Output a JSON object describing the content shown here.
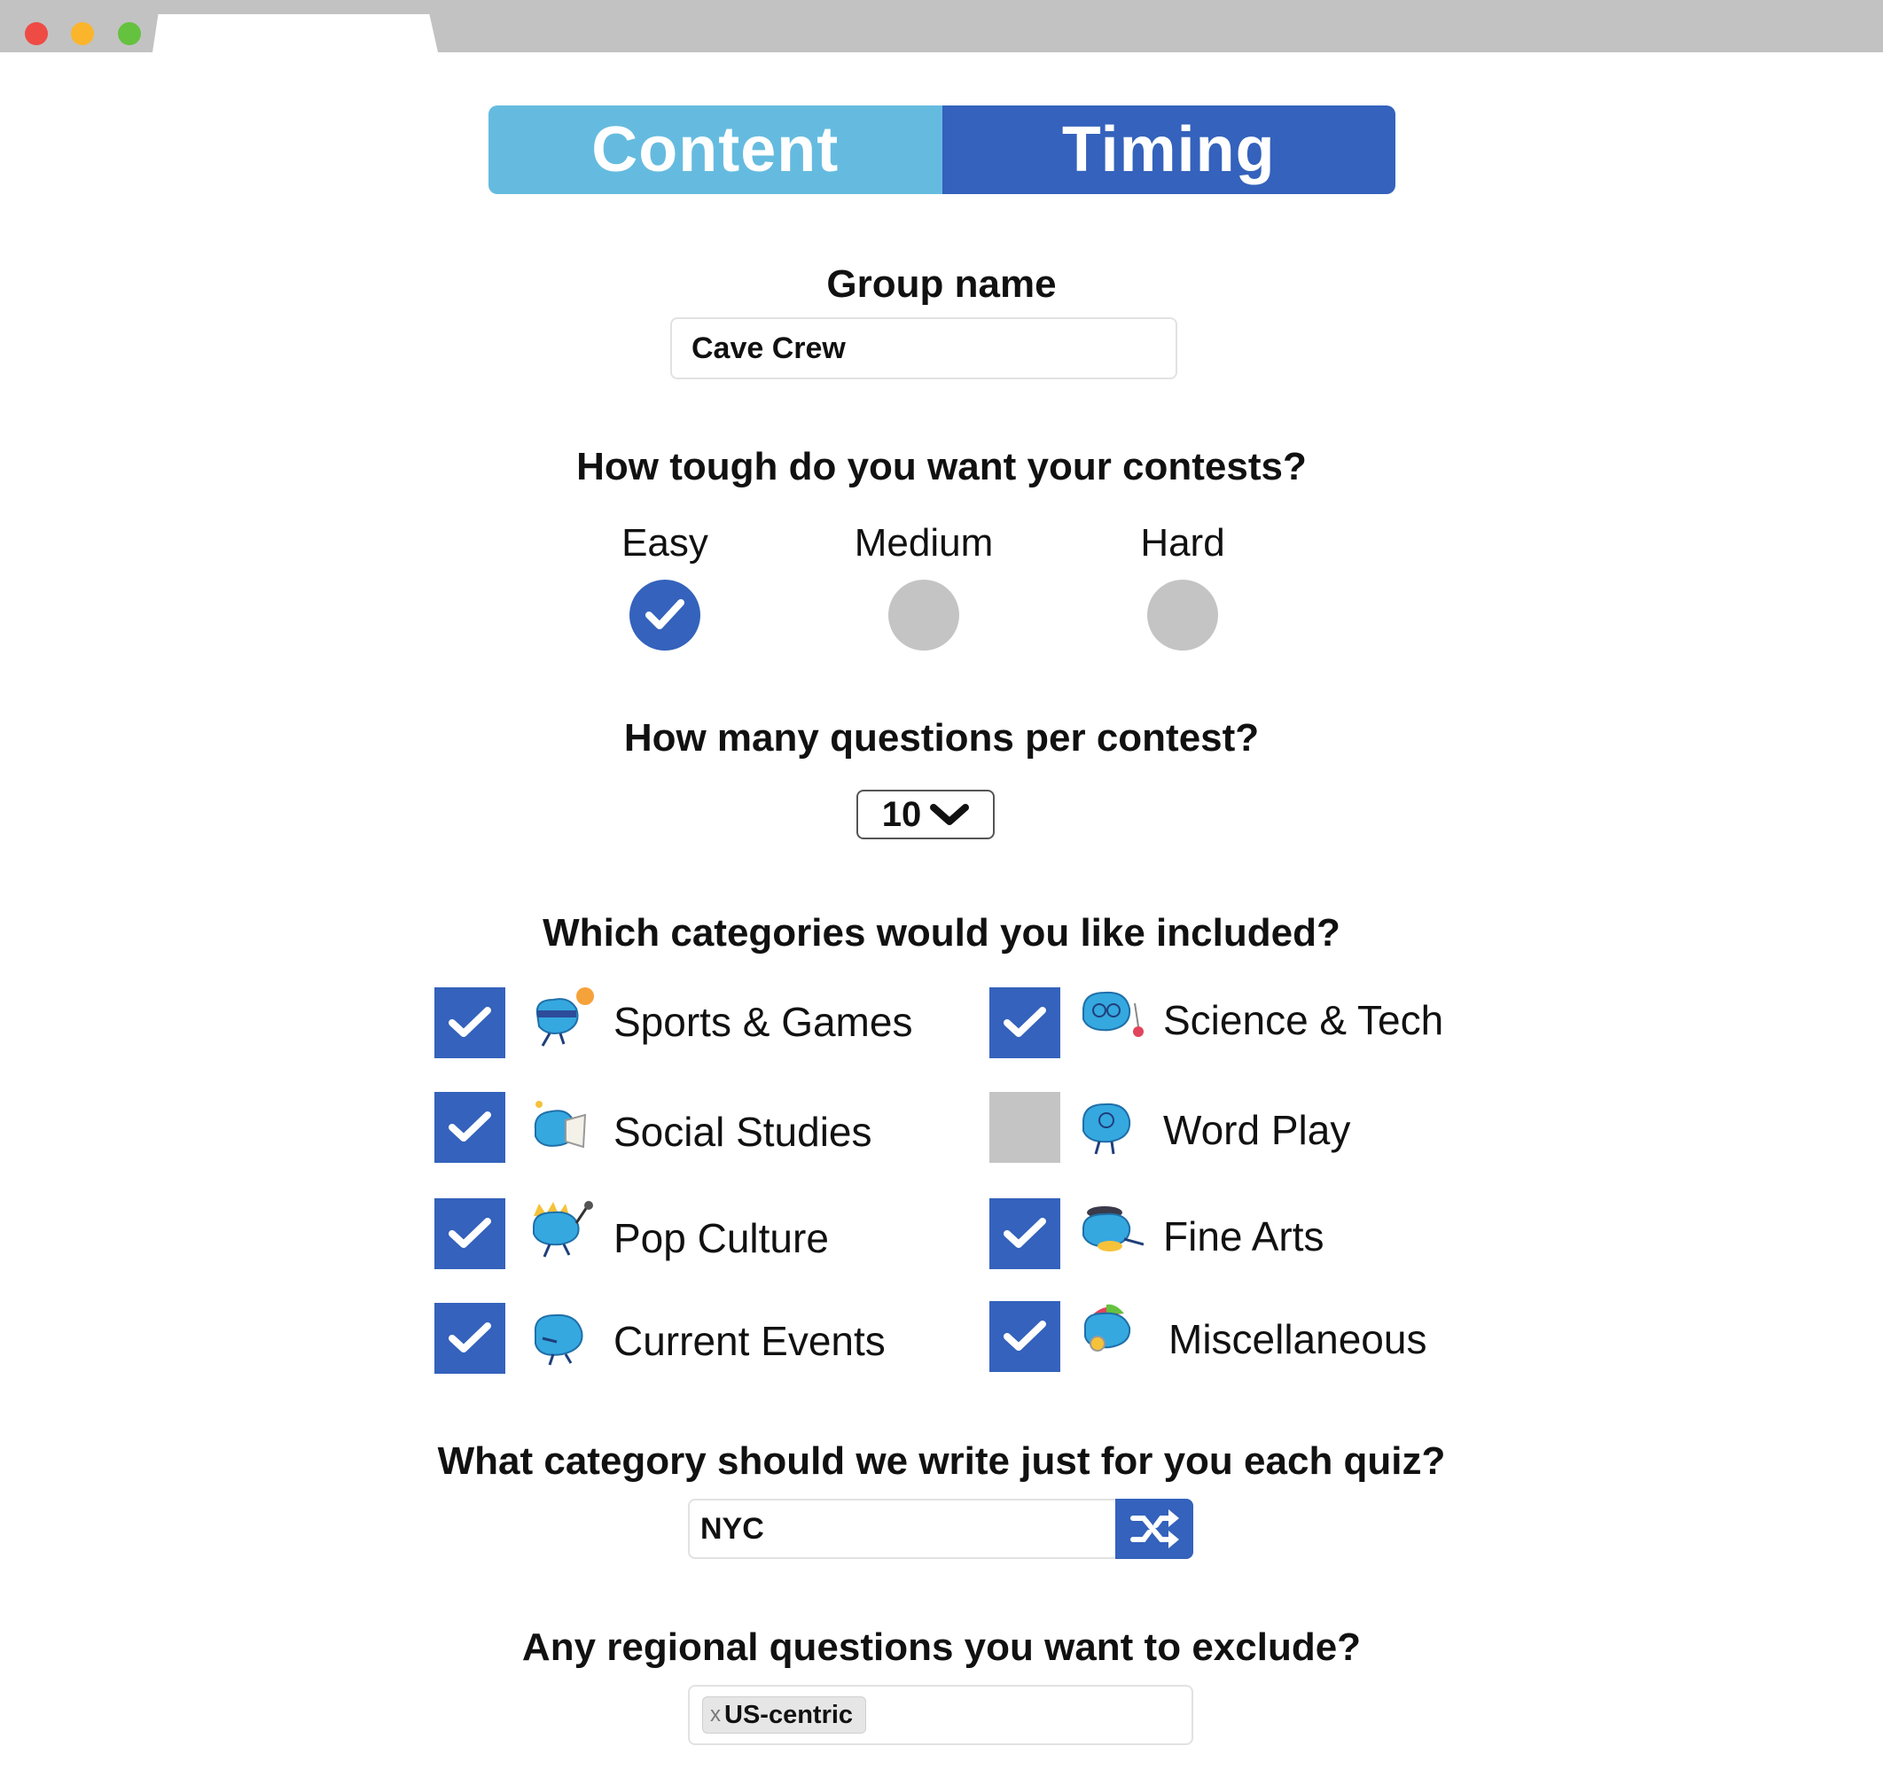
{
  "tabs": {
    "content": "Content",
    "timing": "Timing"
  },
  "group_name": {
    "label": "Group name",
    "value": "Cave Crew"
  },
  "difficulty": {
    "question": "How tough do you want your contests?",
    "options": [
      {
        "label": "Easy",
        "selected": true
      },
      {
        "label": "Medium",
        "selected": false
      },
      {
        "label": "Hard",
        "selected": false
      }
    ]
  },
  "questions": {
    "question": "How many questions per contest?",
    "value": "10"
  },
  "categories": {
    "question": "Which categories would you like included?",
    "items": [
      {
        "label": "Sports & Games",
        "checked": true,
        "icon": "brain-sports-icon"
      },
      {
        "label": "Science & Tech",
        "checked": true,
        "icon": "brain-science-icon"
      },
      {
        "label": "Social Studies",
        "checked": true,
        "icon": "brain-social-icon"
      },
      {
        "label": "Word Play",
        "checked": false,
        "icon": "brain-word-icon"
      },
      {
        "label": "Pop Culture",
        "checked": true,
        "icon": "brain-pop-icon"
      },
      {
        "label": "Fine Arts",
        "checked": true,
        "icon": "brain-arts-icon"
      },
      {
        "label": "Current Events",
        "checked": true,
        "icon": "brain-current-icon"
      },
      {
        "label": "Miscellaneous",
        "checked": true,
        "icon": "brain-misc-icon"
      }
    ]
  },
  "custom_category": {
    "question": "What category should we write just for you each quiz?",
    "value": "NYC",
    "button_icon": "shuffle-icon"
  },
  "regional": {
    "question": "Any regional questions you want to exclude?",
    "chip_remove": "x",
    "chip": "US-centric"
  },
  "colors": {
    "accent": "#3462bc",
    "light_accent": "#65bbdf",
    "unselected": "#c4c4c4",
    "brain": "#35a8e0"
  }
}
